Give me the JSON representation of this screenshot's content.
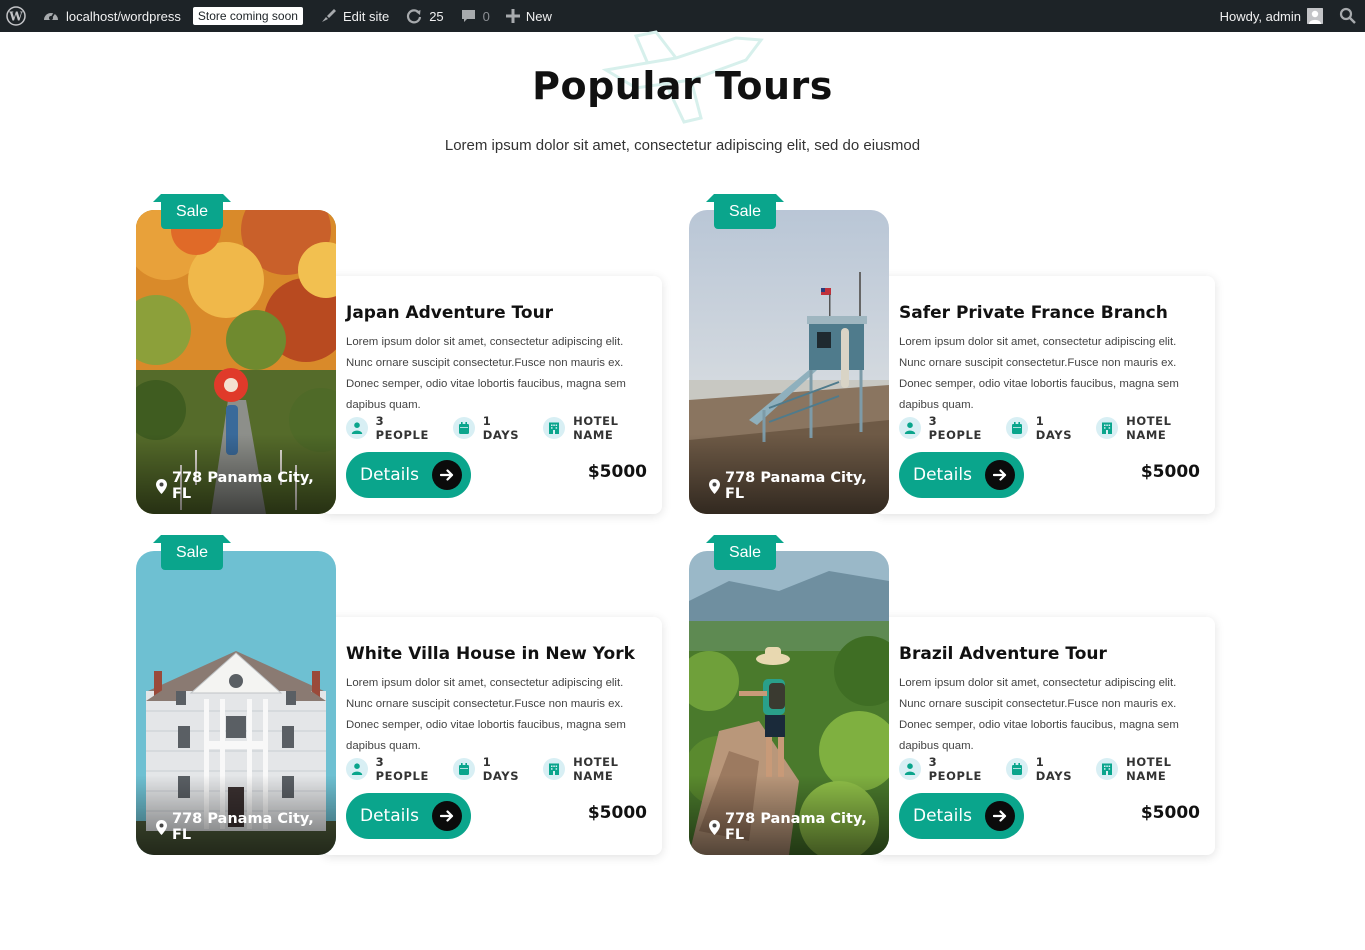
{
  "adminbar": {
    "site": "localhost/wordpress",
    "store_badge": "Store coming soon",
    "edit_site": "Edit site",
    "updates": "25",
    "comments": "0",
    "new": "New",
    "howdy": "Howdy, admin"
  },
  "section": {
    "title": "Popular Tours",
    "subtitle": "Lorem ipsum dolor sit amet, consectetur adipiscing elit, sed do eiusmod"
  },
  "colors": {
    "accent": "#0aa58c",
    "adminbar": "#1d2327"
  },
  "tours": [
    {
      "sale": "Sale",
      "title": "Japan Adventure Tour",
      "description": "Lorem ipsum dolor sit amet, consectetur adipiscing elit. Nunc ornare suscipit consectetur.Fusce non mauris ex. Donec semper, odio vitae lobortis faucibus, magna sem dapibus quam.",
      "people": "3 PEOPLE",
      "days": "1 DAYS",
      "hotel": "HOTEL NAME",
      "button": "Details",
      "price": "$5000",
      "location": "778 Panama City, FL"
    },
    {
      "sale": "Sale",
      "title": "Safer Private France Branch",
      "description": "Lorem ipsum dolor sit amet, consectetur adipiscing elit. Nunc ornare suscipit consectetur.Fusce non mauris ex. Donec semper, odio vitae lobortis faucibus, magna sem dapibus quam.",
      "people": "3 PEOPLE",
      "days": "1 DAYS",
      "hotel": "HOTEL NAME",
      "button": "Details",
      "price": "$5000",
      "location": "778 Panama City, FL"
    },
    {
      "sale": "Sale",
      "title": "White Villa House in New York",
      "description": "Lorem ipsum dolor sit amet, consectetur adipiscing elit. Nunc ornare suscipit consectetur.Fusce non mauris ex. Donec semper, odio vitae lobortis faucibus, magna sem dapibus quam.",
      "people": "3 PEOPLE",
      "days": "1 DAYS",
      "hotel": "HOTEL NAME",
      "button": "Details",
      "price": "$5000",
      "location": "778 Panama City, FL"
    },
    {
      "sale": "Sale",
      "title": "Brazil Adventure Tour",
      "description": "Lorem ipsum dolor sit amet, consectetur adipiscing elit. Nunc ornare suscipit consectetur.Fusce non mauris ex. Donec semper, odio vitae lobortis faucibus, magna sem dapibus quam.",
      "people": "3 PEOPLE",
      "days": "1 DAYS",
      "hotel": "HOTEL NAME",
      "button": "Details",
      "price": "$5000",
      "location": "778 Panama City, FL"
    }
  ]
}
